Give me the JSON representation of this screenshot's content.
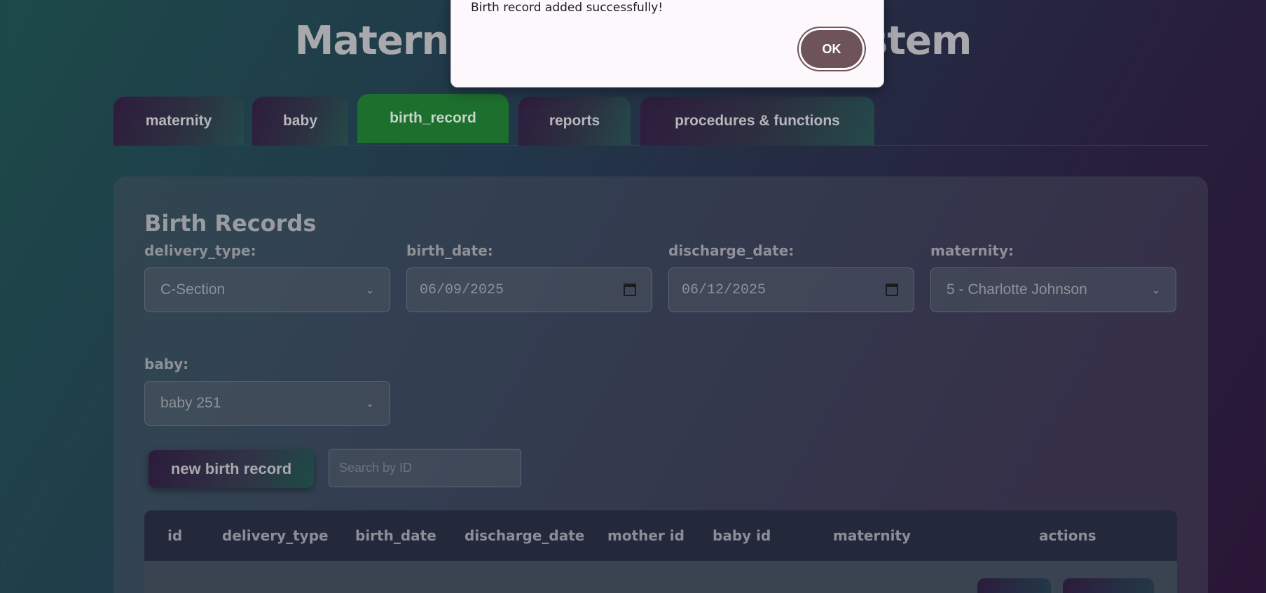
{
  "app": {
    "title": "Maternity Management System"
  },
  "tabs": [
    {
      "label": "maternity"
    },
    {
      "label": "baby"
    },
    {
      "label": "birth_record",
      "active": true
    },
    {
      "label": "reports"
    },
    {
      "label": "procedures & functions"
    }
  ],
  "form": {
    "title": "Birth Records",
    "delivery_type": {
      "label": "delivery_type:",
      "value": "C-Section"
    },
    "birth_date": {
      "label": "birth_date:",
      "value": "06/09/2025"
    },
    "discharge_date": {
      "label": "discharge_date:",
      "value": "06/12/2025"
    },
    "maternity": {
      "label": "maternity:",
      "value": "5 - Charlotte Johnson"
    },
    "baby": {
      "label": "baby:",
      "value": "baby 251"
    },
    "new_button": "new birth record",
    "search_placeholder": "Search by ID"
  },
  "table": {
    "columns": [
      "id",
      "delivery_type",
      "birth_date",
      "discharge_date",
      "mother id",
      "baby id",
      "maternity",
      "actions"
    ]
  },
  "dialog": {
    "message": "Birth record added successfully!",
    "ok_label": "OK"
  },
  "colors": {
    "active_tab": "#1d6f2e",
    "ok_button": "#6e5459"
  },
  "icons": {
    "date_picker": "calendar-icon",
    "select_arrow": "chevron-down-icon"
  }
}
